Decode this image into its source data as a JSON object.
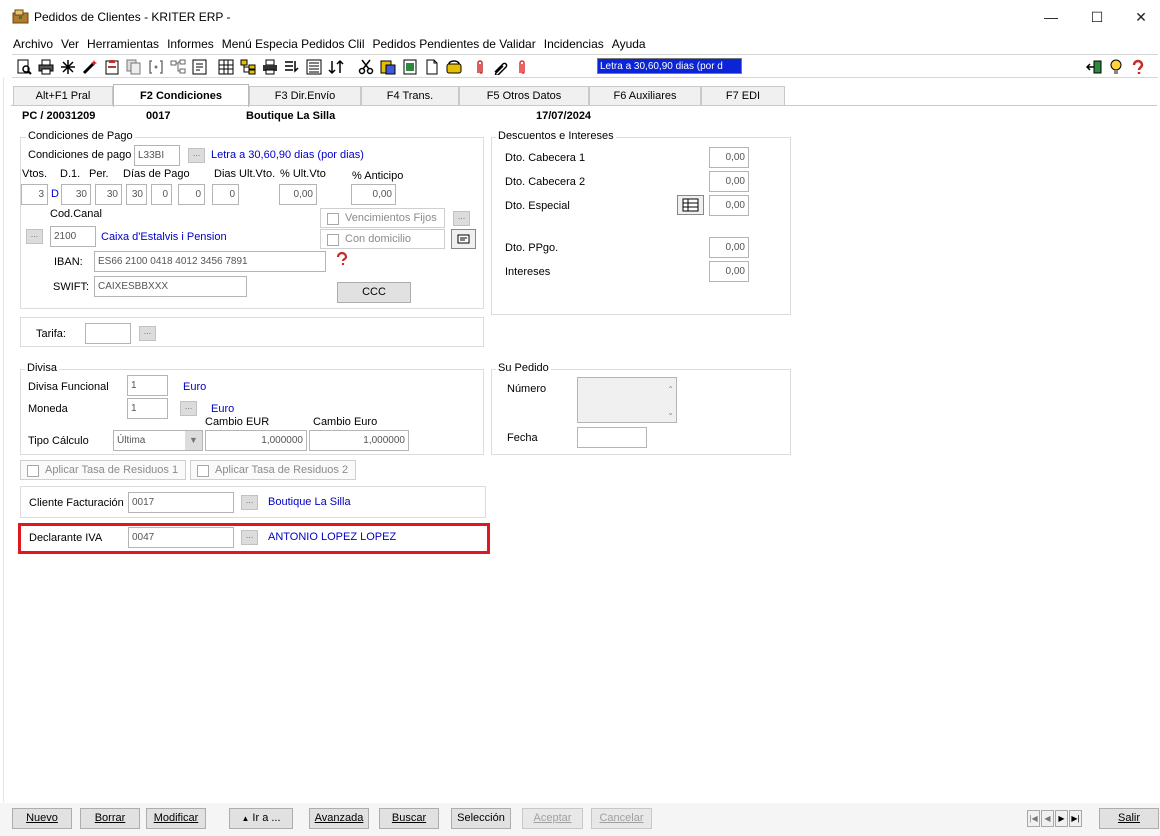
{
  "window": {
    "title": "Pedidos de Clientes - KRITER ERP -",
    "minimize_glyph": "—",
    "maximize_glyph": "☐",
    "close_glyph": "✕"
  },
  "menu": [
    "Archivo",
    "Ver",
    "Herramientas",
    "Informes",
    "Menú Especia Pedidos Clil",
    "Pedidos Pendientes de Validar",
    "Incidencias",
    "Ayuda"
  ],
  "toolbar": {
    "combo_value": "Letra a 30,60,90 dias (por d"
  },
  "tabs": [
    "Alt+F1 Pral",
    "F2 Condiciones",
    "F3 Dir.Envío",
    "F4 Trans.",
    "F5 Otros Datos",
    "F6 Auxiliares",
    "F7 EDI"
  ],
  "header": {
    "doc": "PC / 20031209",
    "code": "0017",
    "name": "Boutique La Silla",
    "date": "17/07/2024"
  },
  "pago": {
    "title": "Condiciones de Pago",
    "cond_label": "Condiciones de pago",
    "cond_code": "L33BI",
    "cond_desc": "Letra a 30,60,90 dias (por dias)",
    "vtos_label": "Vtos.",
    "d1_label": "D.1.",
    "per_label": "Per.",
    "dias_pago_label": "Días de Pago",
    "dias_ult_label": "Dias Ult.Vto.",
    "pct_ult_label": "% Ult.Vto",
    "pct_anticipo_label": "% Anticipo",
    "vtos": "3",
    "d_flag": "D",
    "d1": "30",
    "per": "30",
    "dias": [
      "30",
      "0",
      "0"
    ],
    "dias_ult": "0",
    "pct_ult": "0,00",
    "pct_anticipo": "0,00",
    "venc_fijos": "Vencimientos Fijos",
    "con_domicilio": "Con domicilio",
    "canal_label": "Cod.Canal",
    "canal_code": "2100",
    "canal_desc": "Caixa d'Estalvis i Pension",
    "iban_label": "IBAN:",
    "iban": "ES66 2100 0418 4012 3456 7891",
    "swift_label": "SWIFT:",
    "swift": "CAIXESBBXXX",
    "ccc_label": "CCC"
  },
  "descuentos": {
    "title": "Descuentos e Intereses",
    "rows": [
      {
        "label": "Dto. Cabecera 1",
        "value": "0,00"
      },
      {
        "label": "Dto. Cabecera 2",
        "value": "0,00"
      },
      {
        "label": "Dto. Especial",
        "value": "0,00"
      },
      {
        "label": "Dto. PPgo.",
        "value": "0,00"
      },
      {
        "label": "Intereses",
        "value": "0,00"
      }
    ]
  },
  "tarifa": {
    "label": "Tarifa:",
    "value": ""
  },
  "divisa": {
    "title": "Divisa",
    "funcional_label": "Divisa Funcional",
    "funcional_code": "1",
    "funcional_desc": "Euro",
    "moneda_label": "Moneda",
    "moneda_code": "1",
    "moneda_desc": "Euro",
    "tipo_label": "Tipo Cálculo",
    "tipo_value": "Última",
    "cambio_eur_label": "Cambio EUR",
    "cambio_eur": "1,000000",
    "cambio_euro_label": "Cambio Euro",
    "cambio_euro": "1,000000"
  },
  "su_pedido": {
    "title": "Su Pedido",
    "numero_label": "Número",
    "numero": "",
    "fecha_label": "Fecha",
    "fecha": ""
  },
  "residuos": [
    "Aplicar Tasa de Residuos 1",
    "Aplicar Tasa de Residuos 2"
  ],
  "facturacion": {
    "label": "Cliente Facturación",
    "code": "0017",
    "desc": "Boutique La Silla"
  },
  "declarante": {
    "label": "Declarante IVA",
    "code": "0047",
    "desc": "ANTONIO LOPEZ LOPEZ"
  },
  "buttons": {
    "nuevo": "Nuevo",
    "borrar": "Borrar",
    "modificar": "Modificar",
    "ira": "Ir a ...",
    "avanzada": "Avanzada",
    "buscar": "Buscar",
    "seleccion": "Selección",
    "aceptar": "Aceptar",
    "cancelar": "Cancelar",
    "salir": "Salir"
  }
}
